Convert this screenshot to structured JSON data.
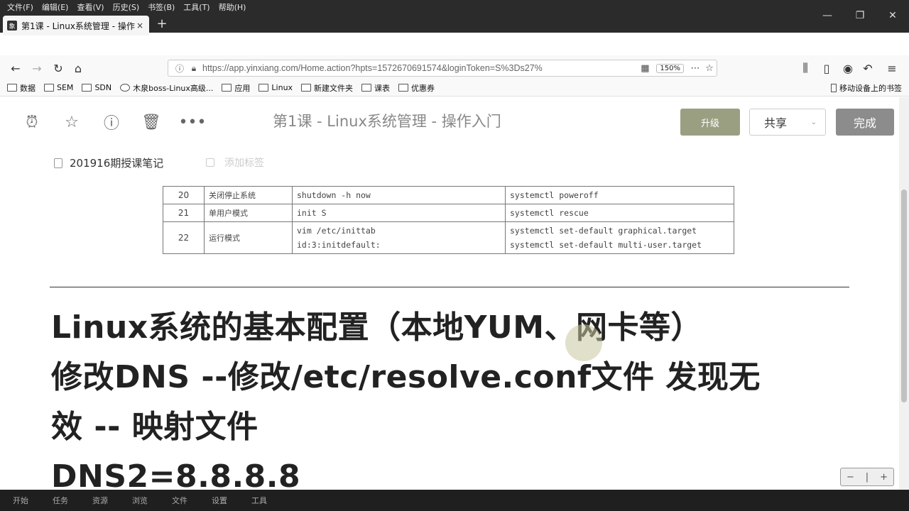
{
  "menubar": {
    "items": [
      "文件(F)",
      "编辑(E)",
      "查看(V)",
      "历史(S)",
      "书签(B)",
      "工具(T)",
      "帮助(H)"
    ]
  },
  "window_controls": {
    "minimize": "—",
    "restore": "❐",
    "close": "✕"
  },
  "tab": {
    "title": "第1课 - Linux系统管理 - 操作入",
    "close": "×",
    "favicon": "象"
  },
  "newtab": "+",
  "address": {
    "url": "https://app.yinxiang.com/Home.action?hpts=1572670691574&loginToken=S%3Ds27%",
    "zoom": "150%"
  },
  "bookmarks": {
    "items": [
      "数据",
      "SEM",
      "SDN",
      "木泉boss-Linux高级...",
      "应用",
      "Linux",
      "新建文件夹",
      "课表",
      "优惠券"
    ],
    "mobile": "移动设备上的书签"
  },
  "note": {
    "title": "第1课 - Linux系统管理 - 操作入门",
    "upgrade": "升级",
    "share": "共享",
    "done": "完成",
    "notebook": "201916期授课笔记",
    "tag_placeholder": "添加标签"
  },
  "table": {
    "rows": [
      {
        "num": "20",
        "name": "关闭停止系统",
        "old": [
          "shutdown -h now"
        ],
        "new": [
          "systemctl poweroff"
        ]
      },
      {
        "num": "21",
        "name": "单用户模式",
        "old": [
          "init S"
        ],
        "new": [
          "systemctl rescue"
        ]
      },
      {
        "num": "22",
        "name": "运行模式",
        "old": [
          "vim /etc/inittab",
          "id:3:initdefault:"
        ],
        "new": [
          "systemctl set-default graphical.target",
          "systemctl set-default multi-user.target"
        ]
      }
    ]
  },
  "body_lines": [
    "Linux系统的基本配置（本地YUM、网卡等）",
    "修改DNS --修改/etc/resolve.conf文件 发现无",
    "效  -- 映射文件",
    "DNS2=8.8.8.8"
  ],
  "zoom_controls": {
    "minus": "−",
    "divider": "|",
    "plus": "+"
  },
  "taskbar": {
    "items": [
      "开始",
      "任务",
      "资源",
      "浏览",
      "文件",
      "设置",
      "工具"
    ]
  }
}
